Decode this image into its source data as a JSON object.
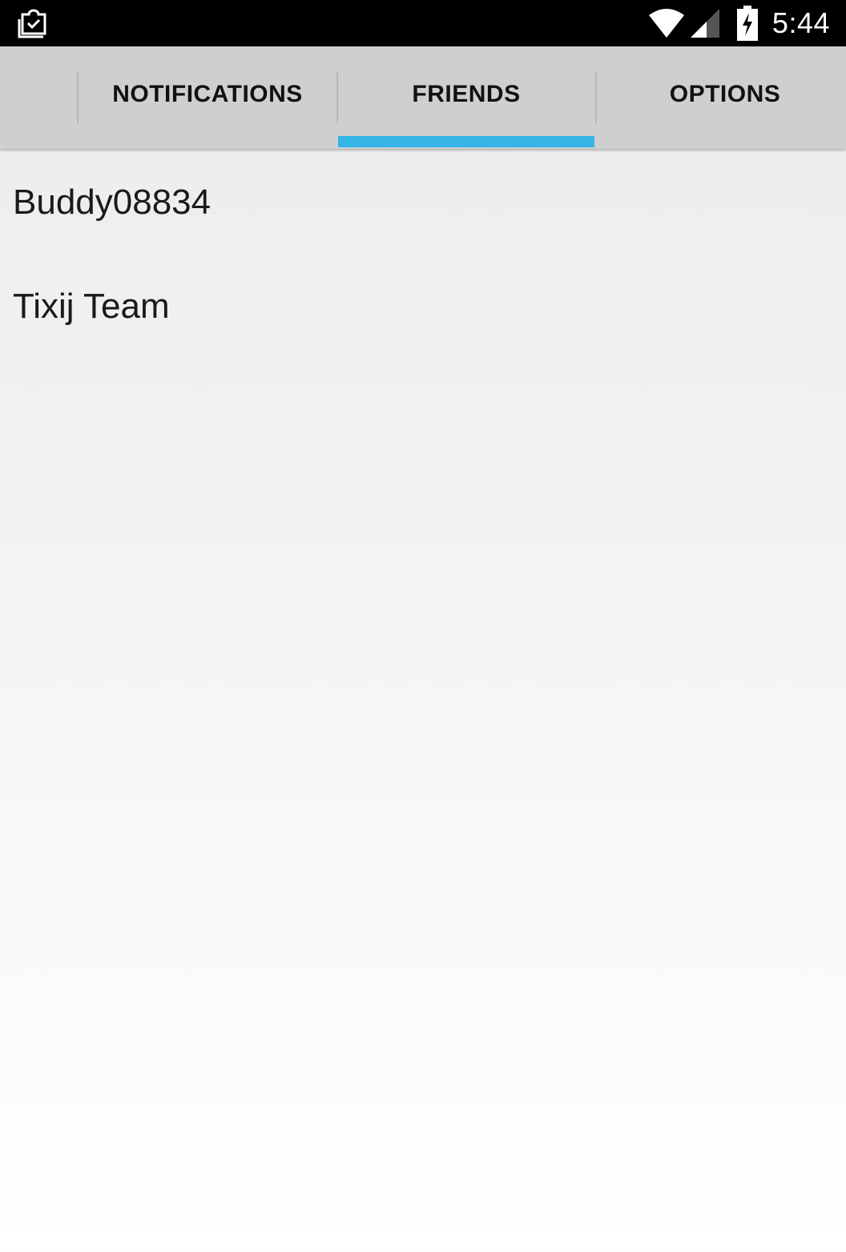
{
  "status_bar": {
    "left_icon": "clipboard-check-icon",
    "wifi_icon": "wifi-icon",
    "signal_icon": "cell-signal-icon",
    "battery_icon": "battery-charging-icon",
    "time": "5:44"
  },
  "tabs": [
    {
      "label": "NOTIFICATIONS",
      "selected": false
    },
    {
      "label": "FRIENDS",
      "selected": true
    },
    {
      "label": "OPTIONS",
      "selected": false
    }
  ],
  "accent_color": "#33b5e5",
  "friends": [
    {
      "name": "Buddy08834"
    },
    {
      "name": "Tixij Team"
    }
  ]
}
